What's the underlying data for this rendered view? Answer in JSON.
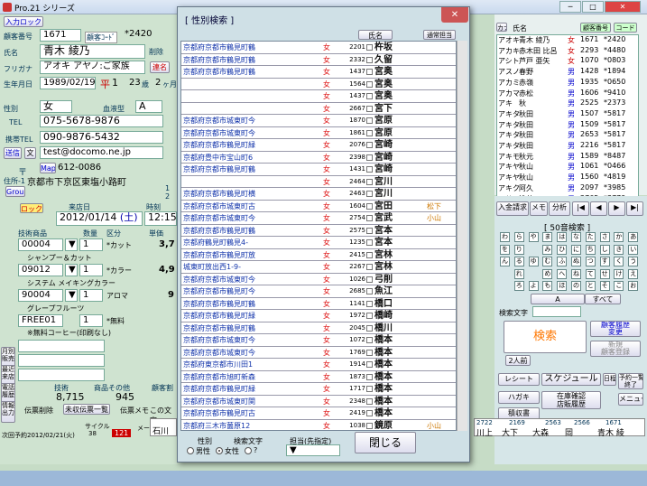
{
  "window": {
    "title": "Pro.21 シリーズ"
  },
  "left": {
    "top_btn": "入力ロック",
    "member_no_label": "顧客番号",
    "member_no": "1671",
    "code_label": "顧客ｺｰﾄﾞ",
    "code": "*2420",
    "name_label": "氏名",
    "name": "青木 綾乃",
    "delete_label": "削除",
    "furigana_label": "フリガナ",
    "furigana": "アオキ アヤノ:ご家族",
    "renraku": "連名",
    "birth_label": "生年月日",
    "birth": "1989/02/19",
    "era": "平",
    "era_year": "1",
    "age": "23",
    "age_unit": "歳",
    "month": "2",
    "month_unit": "ヶ月",
    "sex_label": "性別",
    "sex": "女",
    "blood_label": "血液型",
    "blood": "A",
    "tel_label": "TEL",
    "tel": "075-5678-9876",
    "mobile_label": "携帯TEL",
    "mobile": "090-9876-5432",
    "mail_btn": "送信",
    "mail_btn2": "文",
    "mail": "test@docomo.ne.jp",
    "zip_label": "〒",
    "zip_btn": "Map",
    "zip": "612-0086",
    "addr_label": "住所-1",
    "addr": "京都市下京区東塩小路町",
    "group": "Group",
    "group_n1": "1",
    "group_n2": "2"
  },
  "visit": {
    "lock": "ロック中",
    "date_label": "来店日",
    "time_label": "時刻",
    "date": "2012/01/14",
    "dow": "(土)",
    "time": "12:15",
    "headers": [
      "技術商品",
      "数量",
      "区分",
      "単価"
    ],
    "items": [
      {
        "code": "00004",
        "qty": "1",
        "kind": "*カット",
        "price": "3,7",
        "name": "シャンプー＆カット"
      },
      {
        "code": "09012",
        "qty": "1",
        "kind": "*カラー",
        "price": "4,9",
        "name": "システム メイキングカラー"
      },
      {
        "code": "90004",
        "qty": "1",
        "kind": "アロマ",
        "price": "9",
        "name": "グレープフルーツ"
      },
      {
        "code": "FREE01",
        "qty": "1",
        "kind": "*無料",
        "price": "",
        "name": "※無料コーヒー(印刷なし)"
      }
    ],
    "side_btns": [
      "月別販売",
      "最近来店",
      "電話履歴",
      "情報出力"
    ],
    "total_headers": [
      "技術",
      "商品その他",
      "顧客割"
    ],
    "tech_total": "8,715",
    "goods_total": "945",
    "slip_del": "伝票削除",
    "unsettled": "未収伝票一覧",
    "slip_memo": "伝票メモ",
    "this_slip": "この文字",
    "next_label": "次回予約",
    "next_date": "2012/02/21(火)",
    "cycle_label": "サイクル",
    "cycle": "38",
    "cycle2": "121",
    "mail_label": "メール"
  },
  "dialog": {
    "title": "[ 性別検索 ]",
    "close": "✕",
    "btn_name": "氏名",
    "btn_visit": "通常担当",
    "rows": [
      {
        "addr": "京都府京都市鶴見町鶴",
        "sex": "女",
        "num": "2201",
        "name": "杵坂",
        "note": ""
      },
      {
        "addr": "京都府京都市鶴見町鶴",
        "sex": "女",
        "num": "2332",
        "name": "久留",
        "note": ""
      },
      {
        "addr": "京都府京都市鶴見町鶴",
        "sex": "女",
        "num": "1437",
        "name": "宮奥",
        "note": ""
      },
      {
        "addr": "",
        "sex": "女",
        "num": "1564",
        "name": "宮奥",
        "note": ""
      },
      {
        "addr": "",
        "sex": "女",
        "num": "1437",
        "name": "宮奥",
        "note": ""
      },
      {
        "addr": "",
        "sex": "女",
        "num": "2667",
        "name": "宮下",
        "note": ""
      },
      {
        "addr": "京都府京都市城東町今",
        "sex": "女",
        "num": "1870",
        "name": "宮原",
        "note": ""
      },
      {
        "addr": "京都府京都市城東町今",
        "sex": "女",
        "num": "1861",
        "name": "宮原",
        "note": ""
      },
      {
        "addr": "京都府京都市鶴見町緑",
        "sex": "女",
        "num": "2076",
        "name": "宮崎",
        "note": ""
      },
      {
        "addr": "京都府豊中市宝山町6",
        "sex": "女",
        "num": "2398",
        "name": "宮崎",
        "note": ""
      },
      {
        "addr": "京都府京都市鶴見町鶴",
        "sex": "女",
        "num": "1431",
        "name": "宮崎",
        "note": ""
      },
      {
        "addr": "",
        "sex": "女",
        "num": "2464",
        "name": "宮川",
        "note": ""
      },
      {
        "addr": "京都府京都市鶴見町横",
        "sex": "女",
        "num": "2463",
        "name": "宮川",
        "note": ""
      },
      {
        "addr": "京都府京都市城東町古",
        "sex": "女",
        "num": "1604",
        "name": "宮田",
        "note": "松下"
      },
      {
        "addr": "京都府京都市城東町今",
        "sex": "女",
        "num": "2754",
        "name": "宮武",
        "note": "小山"
      },
      {
        "addr": "京都府京都市鶴見町鶴",
        "sex": "女",
        "num": "2575",
        "name": "宮本",
        "note": ""
      },
      {
        "addr": "京都府鶴見町鶴見4-",
        "sex": "女",
        "num": "1235",
        "name": "宮本",
        "note": ""
      },
      {
        "addr": "京都府京都市鶴見町放",
        "sex": "女",
        "num": "2415",
        "name": "宮林",
        "note": ""
      },
      {
        "addr": "城東町放出西1-9-",
        "sex": "女",
        "num": "2267",
        "name": "宮林",
        "note": ""
      },
      {
        "addr": "京都府京都市城東町今",
        "sex": "女",
        "num": "1026",
        "name": "弓削",
        "note": ""
      },
      {
        "addr": "京都府京都市鶴見町今",
        "sex": "女",
        "num": "2685",
        "name": "魚江",
        "note": ""
      },
      {
        "addr": "京都府京都市鶴見町鶴",
        "sex": "女",
        "num": "1141",
        "name": "橋口",
        "note": ""
      },
      {
        "addr": "京都府京都市鶴見町緑",
        "sex": "女",
        "num": "1972",
        "name": "橋崎",
        "note": ""
      },
      {
        "addr": "京都府京都市鶴見町鶴",
        "sex": "女",
        "num": "2045",
        "name": "橋川",
        "note": ""
      },
      {
        "addr": "京都府京都市城東町今",
        "sex": "女",
        "num": "1072",
        "name": "橋本",
        "note": ""
      },
      {
        "addr": "京都府京都市城東町今",
        "sex": "女",
        "num": "1769",
        "name": "橋本",
        "note": ""
      },
      {
        "addr": "京都府東京都市川田1",
        "sex": "女",
        "num": "1914",
        "name": "橋本",
        "note": ""
      },
      {
        "addr": "京都府京都市旭町新森",
        "sex": "女",
        "num": "1873",
        "name": "橋本",
        "note": ""
      },
      {
        "addr": "京都府京都市鶴見町緑",
        "sex": "女",
        "num": "1717",
        "name": "橋本",
        "note": ""
      },
      {
        "addr": "京都府京都市城東町関",
        "sex": "女",
        "num": "2348",
        "name": "橋本",
        "note": ""
      },
      {
        "addr": "京都府京都市鶴見町古",
        "sex": "女",
        "num": "2419",
        "name": "橋本",
        "note": ""
      },
      {
        "addr": "京都府三木市薗原12",
        "sex": "女",
        "num": "1038",
        "name": "鏡原",
        "note": "小山"
      }
    ],
    "footer_sex": "性別",
    "footer_search": "検索文字",
    "footer_staff": "担当(先指定)",
    "radios": [
      "男性",
      "女性",
      "?"
    ],
    "close_btn": "閉じる"
  },
  "rlist": {
    "headers": [
      "カナ",
      "氏名",
      "顧客番号",
      "コード"
    ],
    "rows": [
      {
        "kana": "アオキ",
        "name": "青木 綾乃",
        "sex": "女",
        "no": "1671",
        "code": "*2420"
      },
      {
        "kana": "アカキ",
        "name": "赤木田 比呂",
        "sex": "女",
        "no": "2293",
        "code": "*4480"
      },
      {
        "kana": "アシト",
        "name": "芦戸 亜矢",
        "sex": "女",
        "no": "1070",
        "code": "*0803"
      },
      {
        "kana": "アスノ",
        "name": "春野",
        "sex": "男",
        "no": "1428",
        "code": "*1894"
      },
      {
        "kana": "アカミ",
        "name": "赤嶺",
        "sex": "男",
        "no": "1935",
        "code": "*0650"
      },
      {
        "kana": "アカマ",
        "name": "赤松",
        "sex": "男",
        "no": "1606",
        "code": "*9410"
      },
      {
        "kana": "アキ",
        "name": "秋",
        "sex": "男",
        "no": "2525",
        "code": "*2373"
      },
      {
        "kana": "アキタ",
        "name": "秋田",
        "sex": "男",
        "no": "1507",
        "code": "*5817"
      },
      {
        "kana": "アキタ",
        "name": "秋田",
        "sex": "男",
        "no": "1509",
        "code": "*5817"
      },
      {
        "kana": "アキタ",
        "name": "秋田",
        "sex": "男",
        "no": "2653",
        "code": "*5817"
      },
      {
        "kana": "アキタ",
        "name": "秋田",
        "sex": "男",
        "no": "2216",
        "code": "*5817"
      },
      {
        "kana": "アキモ",
        "name": "秋元",
        "sex": "男",
        "no": "1589",
        "code": "*8487"
      },
      {
        "kana": "アキヤ",
        "name": "秋山",
        "sex": "男",
        "no": "1061",
        "code": "*0466"
      },
      {
        "kana": "アキヤ",
        "name": "秋山",
        "sex": "男",
        "no": "1560",
        "code": "*4819"
      },
      {
        "kana": "アキク",
        "name": "阿久",
        "sex": "男",
        "no": "2097",
        "code": "*3985"
      },
      {
        "kana": "アサイ",
        "name": "浅井",
        "sex": "男",
        "no": "2765",
        "code": "*3779"
      }
    ]
  },
  "rbuttons": {
    "top": [
      "入金請求",
      "メモ",
      "分析"
    ],
    "nav": [
      "|◀",
      "◀",
      "▶",
      "▶|"
    ],
    "kana_title": "[ 50音検索 ]",
    "kana": [
      "わ",
      "ら",
      "や",
      "ま",
      "は",
      "な",
      "た",
      "さ",
      "か",
      "あ",
      "を",
      "り",
      "",
      "み",
      "ひ",
      "に",
      "ち",
      "し",
      "き",
      "い",
      "ん",
      "る",
      "ゆ",
      "む",
      "ふ",
      "ぬ",
      "つ",
      "す",
      "く",
      "う",
      "",
      "れ",
      "",
      "め",
      "へ",
      "ね",
      "て",
      "せ",
      "け",
      "え",
      "",
      "ろ",
      "よ",
      "も",
      "ほ",
      "の",
      "と",
      "そ",
      "こ",
      "お"
    ],
    "a_btn": "A",
    "all_btn": "すべて",
    "search_label": "検索文字",
    "search_btn": "検索",
    "history_btn": "顧客履歴",
    "history_btn2": "変更",
    "new_btn": "新規",
    "new_btn2": "顧客登録",
    "persons": "2人前",
    "receipt": "レシート",
    "schedule": "スケジュール",
    "mail": "ハガキ",
    "stock": "在庫確認",
    "stock2": "店販履歴",
    "accounting": "積収書",
    "menu": "メニュー",
    "week": "日程",
    "yoyaku": "予約一覧",
    "yoyaku2": "終了"
  },
  "bottom": {
    "cells": [
      "2722",
      "2169",
      "2563",
      "2566",
      "1671"
    ],
    "names": [
      "石川",
      "川上",
      "大下",
      "大森",
      "岡",
      "青木 綾"
    ]
  }
}
